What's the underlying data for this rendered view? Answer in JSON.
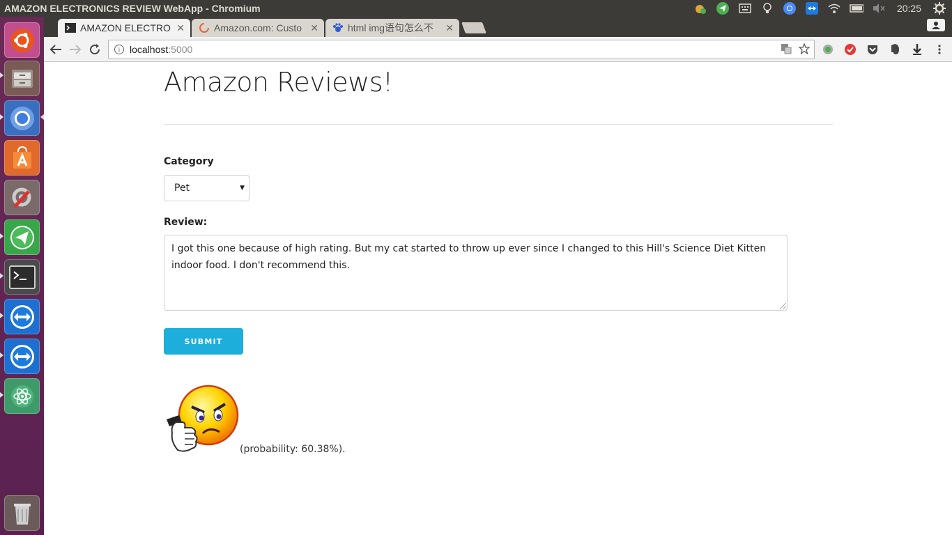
{
  "window": {
    "title": "AMAZON ELECTRONICS REVIEW WebApp - Chromium",
    "clock": "20:25"
  },
  "tabs": [
    {
      "label": "AMAZON ELECTRO",
      "active": true
    },
    {
      "label": "Amazon.com: Custo",
      "active": false
    },
    {
      "label": "html img语句怎么不",
      "active": false
    }
  ],
  "address_bar": {
    "host": "localhost",
    "port": ":5000"
  },
  "page": {
    "heading": "Amazon Reviews!",
    "category_label": "Category",
    "category_value": "Pet",
    "review_label": "Review:",
    "review_text": "I got this one because of high rating. But my cat started to throw up ever since I changed to this Hill's Science Diet Kitten indoor food. I don't recommend this.",
    "submit_label": "SUBMIT",
    "probability_text": "(probability: 60.38%)."
  },
  "colors": {
    "submit_bg": "#1eaedb",
    "launcher_bg": "#5e2750",
    "topbar_bg": "#3c3b37"
  }
}
